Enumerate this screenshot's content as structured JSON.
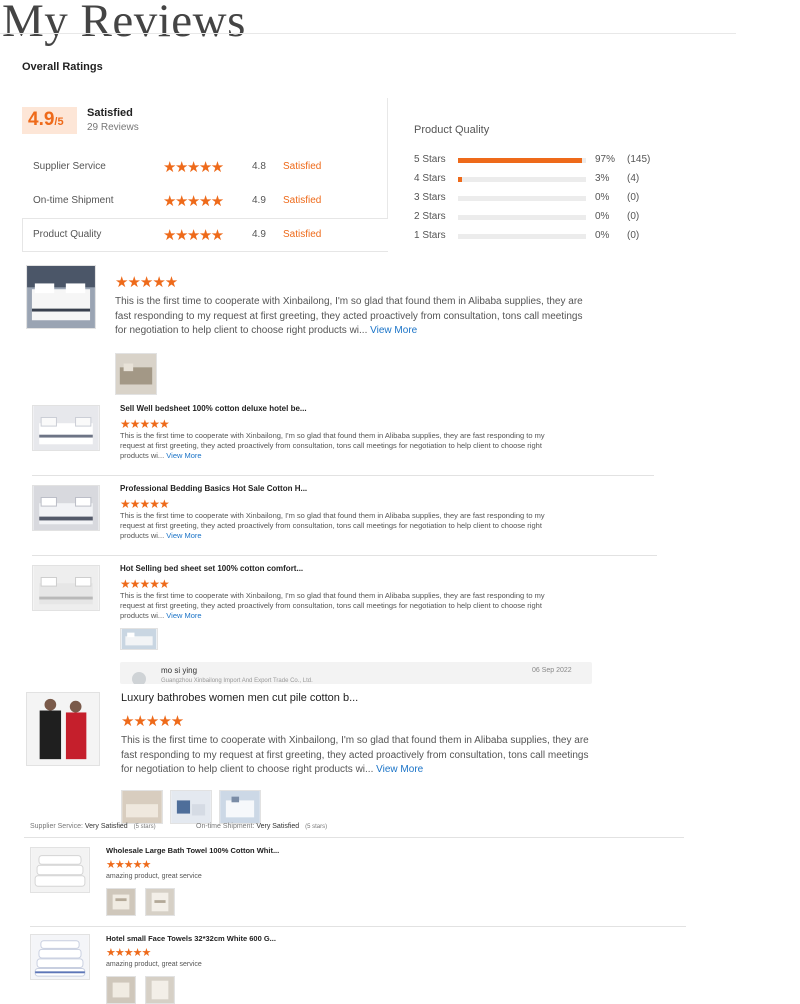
{
  "page_title": "My Reviews",
  "overall": {
    "heading": "Overall Ratings",
    "score": "4.9",
    "score_suffix": "/5",
    "label": "Satisfied",
    "reviews": "29 Reviews",
    "metrics": [
      {
        "label": "Supplier Service",
        "stars": "★★★★★",
        "score": "4.8",
        "word": "Satisfied"
      },
      {
        "label": "On-time Shipment",
        "stars": "★★★★★",
        "score": "4.9",
        "word": "Satisfied"
      },
      {
        "label": "Product Quality",
        "stars": "★★★★★",
        "score": "4.9",
        "word": "Satisfied"
      }
    ]
  },
  "product_quality": {
    "heading": "Product Quality",
    "rows": [
      {
        "label": "5  Stars",
        "fraction": 0.97,
        "pct": "97%",
        "count": "(145)"
      },
      {
        "label": "4  Stars",
        "fraction": 0.03,
        "pct": "3%",
        "count": "(4)"
      },
      {
        "label": "3  Stars",
        "fraction": 0,
        "pct": "0%",
        "count": "(0)"
      },
      {
        "label": "2  Stars",
        "fraction": 0,
        "pct": "0%",
        "count": "(0)"
      },
      {
        "label": "1  Stars",
        "fraction": 0,
        "pct": "0%",
        "count": "(0)"
      }
    ]
  },
  "colors": {
    "accent": "#ee6a1a",
    "link": "#1a73c7",
    "badge_bg": "#fde6d7"
  },
  "review_text": "This is the first time to cooperate with Xinbailong, I'm so glad that found them in Alibaba supplies, they are fast responding to my request at first greeting, they acted proactively from consultation, tons call meetings for negotiation to help client to choose right products wi...",
  "view_more": "View More",
  "stars5": "★★★★★",
  "products": [
    {
      "title": "Sell Well bedsheet 100% cotton deluxe hotel be..."
    },
    {
      "title": "Professional Bedding Basics Hot Sale Cotton H..."
    },
    {
      "title": "Hot Selling bed sheet set 100% cotton comfort..."
    }
  ],
  "reply": {
    "name": "mo si ying",
    "date": "06 Sep 2022",
    "company": "Guangzhou Xinbailong Import And Export Trade Co., Ltd."
  },
  "bathrobe": {
    "title": "Luxury bathrobes women men cut pile cotton b..."
  },
  "meta": {
    "supplier_service_label": "Supplier Service:",
    "supplier_service_value": "Very Satisfied",
    "supplier_service_stars": "(5 stars)",
    "shipment_label": "On-time Shipment:",
    "shipment_value": "Very Satisfied",
    "shipment_stars": "(5 stars)"
  },
  "towels": [
    {
      "title": "Wholesale Large Bath Towel 100% Cotton Whit...",
      "comment": "amazing product, great service"
    },
    {
      "title": "Hotel small Face Towels 32*32cm White 600 G...",
      "comment": "amazing product, great service"
    }
  ]
}
